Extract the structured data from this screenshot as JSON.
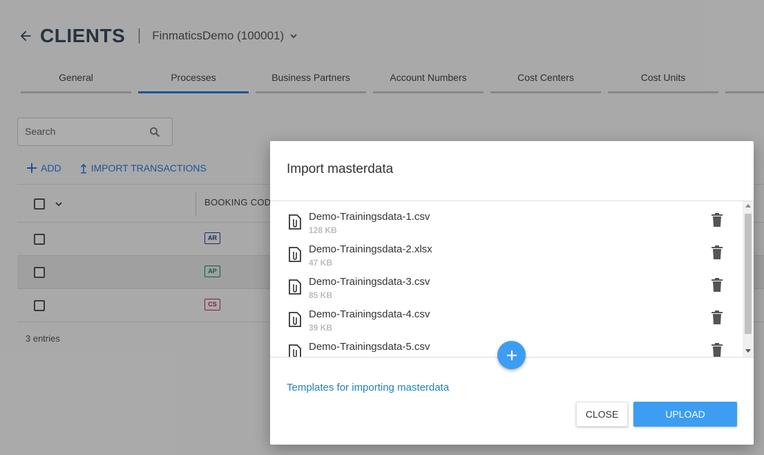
{
  "header": {
    "title": "CLIENTS",
    "client_selector": "FinmaticsDemo (100001)"
  },
  "tabs": [
    {
      "label": "General",
      "active": false
    },
    {
      "label": "Processes",
      "active": true
    },
    {
      "label": "Business Partners",
      "active": false
    },
    {
      "label": "Account Numbers",
      "active": false
    },
    {
      "label": "Cost Centers",
      "active": false
    },
    {
      "label": "Cost Units",
      "active": false
    },
    {
      "label": "",
      "active": false
    }
  ],
  "search": {
    "placeholder": "Search",
    "value": ""
  },
  "actions": {
    "add_label": "ADD",
    "import_label": "IMPORT TRANSACTIONS"
  },
  "table": {
    "columns": [
      "BOOKING CODE"
    ],
    "rows": [
      {
        "code": "AR",
        "color": "#2b3f8c"
      },
      {
        "code": "AP",
        "color": "#178a6a"
      },
      {
        "code": "CS",
        "color": "#c0304e"
      }
    ],
    "entries": "3 entries"
  },
  "modal": {
    "title": "Import masterdata",
    "files": [
      {
        "name": "Demo-Trainingsdata-1.csv",
        "size": "128 KB"
      },
      {
        "name": "Demo-Trainingsdata-2.xlsx",
        "size": "47 KB"
      },
      {
        "name": "Demo-Trainingsdata-3.csv",
        "size": "85 KB"
      },
      {
        "name": "Demo-Trainingsdata-4.csv",
        "size": "39 KB"
      },
      {
        "name": "Demo-Trainingsdata-5.csv",
        "size": ""
      }
    ],
    "templates_link": "Templates for importing masterdata",
    "close_label": "CLOSE",
    "upload_label": "UPLOAD"
  },
  "colors": {
    "accent": "#2a7de1",
    "button_primary": "#3d9df2",
    "link": "#1f7fc9",
    "title": "#3a4a5c"
  }
}
